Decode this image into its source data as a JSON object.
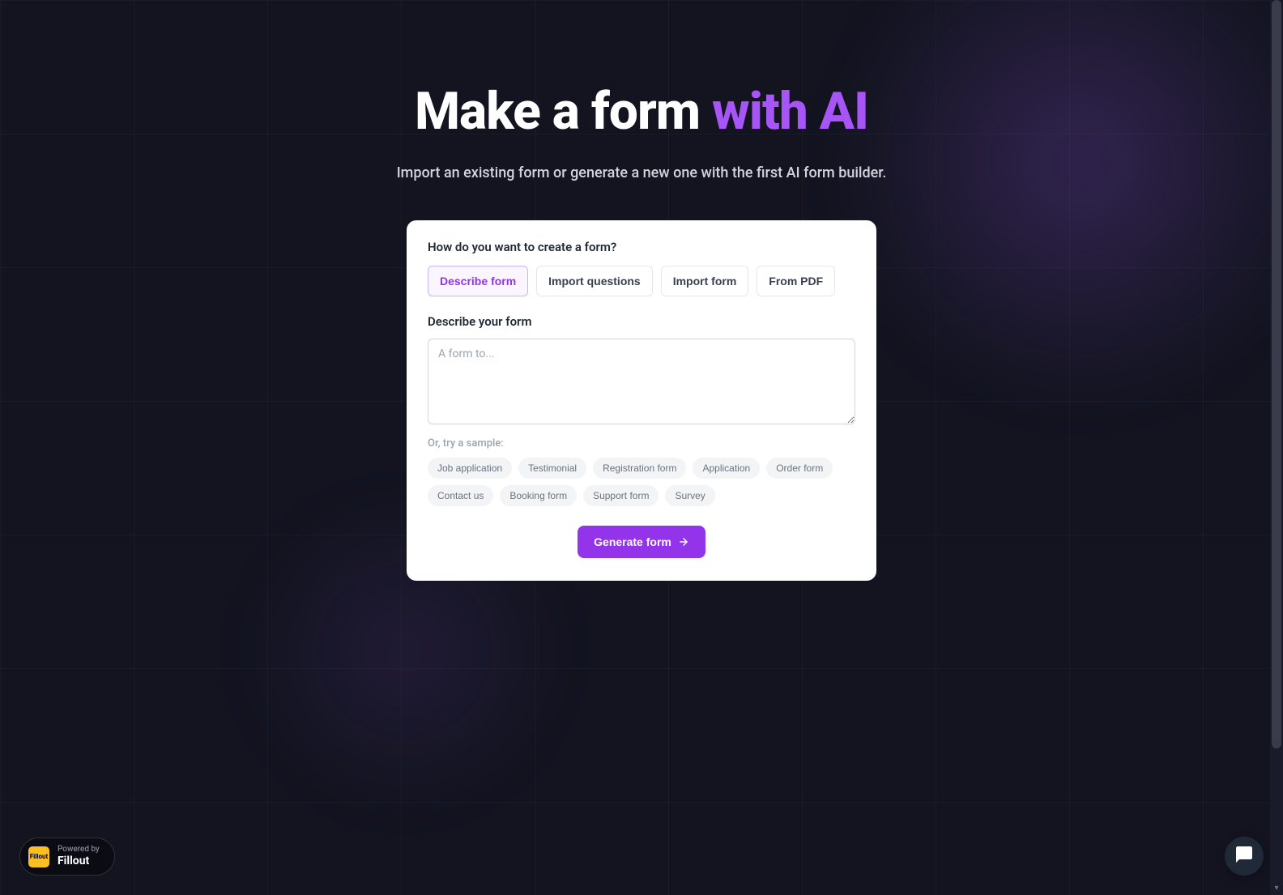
{
  "hero": {
    "title_part1": "Make a form ",
    "title_part2": "with AI",
    "subtitle": "Import an existing form or generate a new one with the first AI form builder."
  },
  "card": {
    "question": "How do you want to create a form?",
    "tabs": [
      {
        "label": "Describe form",
        "active": true
      },
      {
        "label": "Import questions",
        "active": false
      },
      {
        "label": "Import form",
        "active": false
      },
      {
        "label": "From PDF",
        "active": false
      }
    ],
    "form_label": "Describe your form",
    "textarea_placeholder": "A form to...",
    "textarea_value": "",
    "sample_label": "Or, try a sample:",
    "samples": [
      "Job application",
      "Testimonial",
      "Registration form",
      "Application",
      "Order form",
      "Contact us",
      "Booking form",
      "Support form",
      "Survey"
    ],
    "generate_label": "Generate form"
  },
  "powered_by": {
    "top": "Powered by",
    "brand": "Fillout",
    "logo_text": "Fillout"
  }
}
